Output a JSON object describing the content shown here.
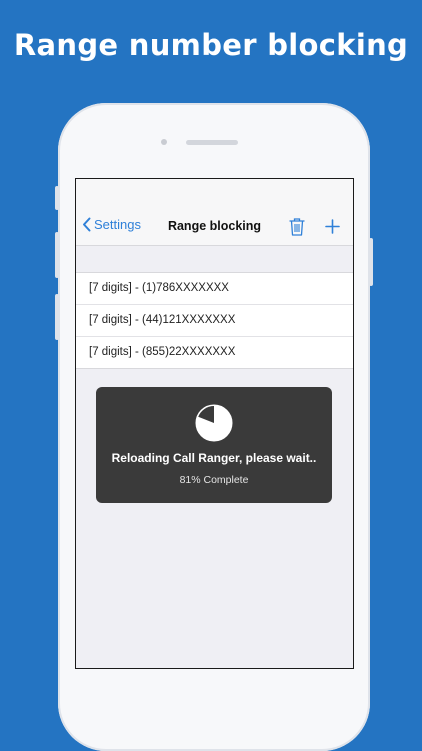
{
  "promo": {
    "headline": "Range number blocking"
  },
  "navbar": {
    "back_label": "Settings",
    "title": "Range blocking",
    "accent_color": "#2f80d8",
    "icons": {
      "back": "chevron-left-icon",
      "delete": "trash-icon",
      "add": "plus-icon"
    }
  },
  "ranges": [
    {
      "label": "[7 digits] - (1)786XXXXXXX"
    },
    {
      "label": "[7 digits] - (44)121XXXXXXX"
    },
    {
      "label": "[7 digits] - (855)22XXXXXXX"
    }
  ],
  "progress": {
    "message": "Reloading Call Ranger, please wait..",
    "detail": "81% Complete",
    "fraction": 0.81,
    "icon": "pie-progress-icon"
  },
  "colors": {
    "background": "#2474c2",
    "hud": "#3a3a3a"
  }
}
